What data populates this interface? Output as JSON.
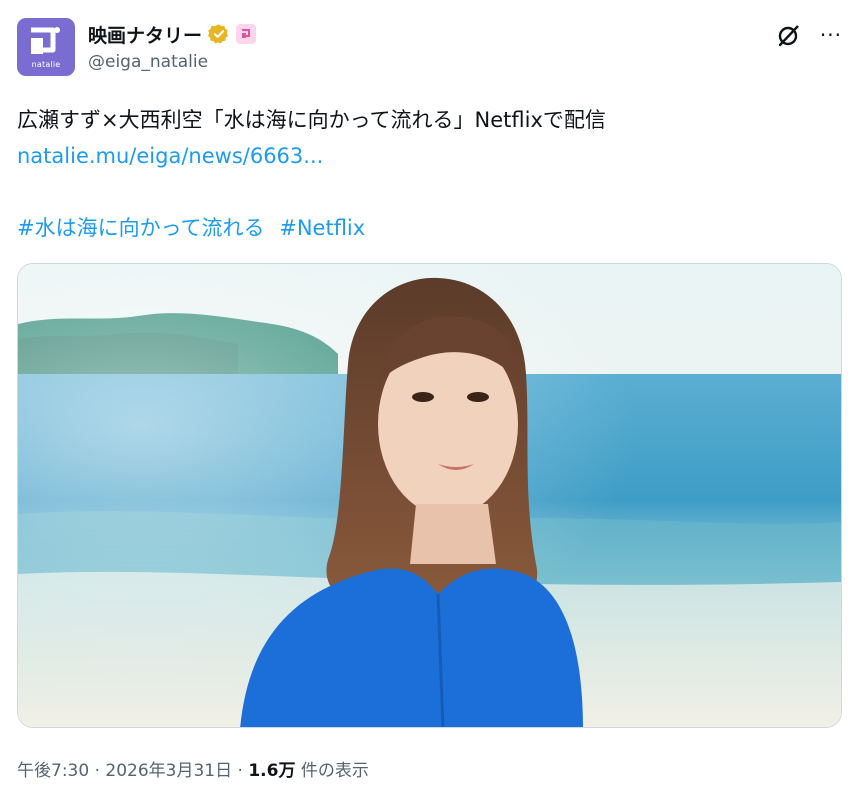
{
  "account": {
    "display_name": "映画ナタリー",
    "handle": "@eiga_natalie",
    "avatar_caption": "natalie",
    "verified_color": "#e8b524",
    "affiliate_badge_color": "#e0549b"
  },
  "toolbar": {
    "grok_icon": "grok-slash-circle-icon",
    "more_label": "···"
  },
  "tweet": {
    "text": "広瀬すず×大西利空「水は海に向かって流れる」Netflixで配信",
    "link": "natalie.mu/eiga/news/6663...",
    "hashtags": [
      "#水は海に向かって流れる",
      "#Netflix"
    ]
  },
  "media": {
    "subject": "photo-portrait-seaside"
  },
  "meta": {
    "time": "午後7:30",
    "sep1": " · ",
    "date": "2026年3月31日",
    "sep2": " · ",
    "views_count": "1.6万",
    "views_label": " 件の表示"
  },
  "colors": {
    "link": "#1d9bf0",
    "text": "#0f1419",
    "secondary": "#536471",
    "avatar_bg": "#7a6cd0"
  }
}
